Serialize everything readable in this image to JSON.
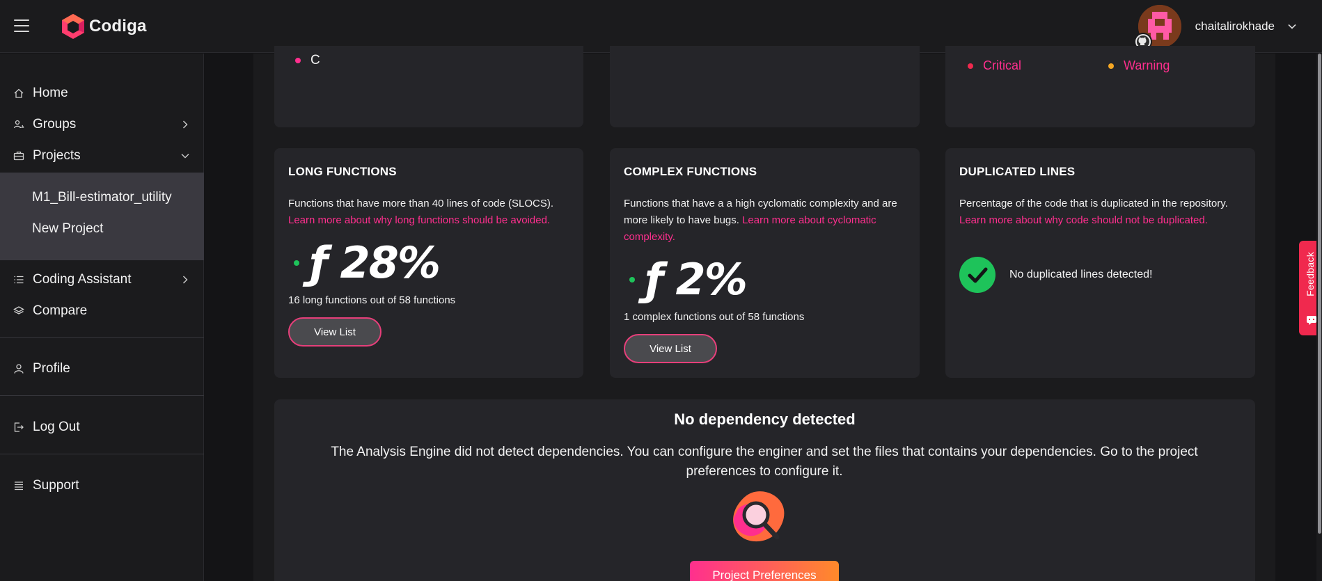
{
  "header": {
    "app_name": "Codiga",
    "username": "chaitalirokhade"
  },
  "sidebar": {
    "items": [
      {
        "label": "Home"
      },
      {
        "label": "Groups"
      },
      {
        "label": "Projects"
      },
      {
        "label": "Coding Assistant"
      },
      {
        "label": "Compare"
      },
      {
        "label": "Profile"
      },
      {
        "label": "Log Out"
      },
      {
        "label": "Support"
      }
    ],
    "projects": [
      "M1_Bill-estimator_utility",
      "New Project"
    ]
  },
  "top_cards": {
    "languages_item": "C",
    "legend_critical": "Critical",
    "legend_warning": "Warning"
  },
  "long_functions": {
    "title": "LONG FUNCTIONS",
    "desc": "Functions that have more than 40 lines of code (SLOCS).",
    "link": "Learn more about why long functions should be avoided.",
    "value": "ƒ 28%",
    "summary": "16 long functions out of 58 functions",
    "button": "View List"
  },
  "complex_functions": {
    "title": "COMPLEX FUNCTIONS",
    "desc": "Functions that have a a high cyclomatic complexity and are more likely to have bugs.",
    "link": "Learn more about cyclomatic complexity.",
    "value": "ƒ 2%",
    "summary": "1 complex functions out of 58 functions",
    "button": "View List"
  },
  "duplicated_lines": {
    "title": "DUPLICATED LINES",
    "desc": "Percentage of the code that is duplicated in the repository.",
    "link": "Learn more about why code should not be duplicated.",
    "status": "No duplicated lines detected!"
  },
  "dependencies": {
    "title": "No dependency detected",
    "desc": "The Analysis Engine did not detect dependencies. You can configure the enginer and set the files that contains your dependencies. Go to the project preferences to configure it.",
    "button": "Project Preferences"
  },
  "feedback": {
    "label": "Feedback"
  },
  "colors": {
    "accent_pink": "#ff2f8e",
    "accent_orange": "#ff8a2a",
    "success_green": "#1ec35a",
    "critical_red": "#f0294e",
    "warning_orange": "#f5a623"
  }
}
